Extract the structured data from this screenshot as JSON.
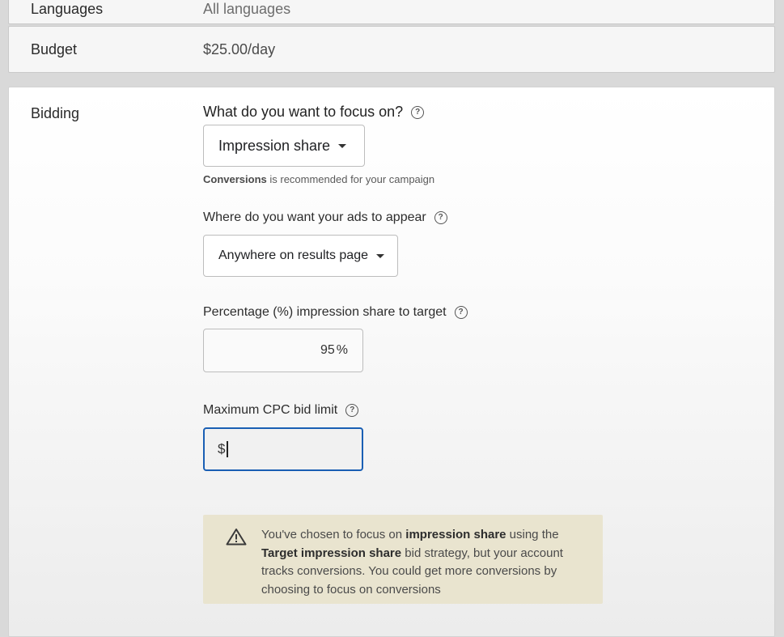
{
  "languages": {
    "label": "Languages",
    "value": "All languages"
  },
  "budget": {
    "label": "Budget",
    "value": "$25.00/day"
  },
  "bidding": {
    "label": "Bidding",
    "focus": {
      "question": "What do you want to focus on?",
      "selected": "Impression share",
      "hint_bold": "Conversions",
      "hint_rest": " is recommended for your campaign"
    },
    "location": {
      "question": "Where do you want your ads to appear",
      "selected": "Anywhere on results page"
    },
    "percentage": {
      "question": "Percentage (%) impression share to target",
      "value": "95",
      "unit": "%"
    },
    "cpc": {
      "question": "Maximum CPC bid limit",
      "prefix": "$",
      "value": ""
    },
    "warning": {
      "part1": "You've chosen to focus on ",
      "bold1": "impression share",
      "part2": " using the ",
      "bold2": "Target impression share",
      "part3": " bid strategy, but your account tracks conversions. You could get more conversions by choosing to focus on conversions"
    }
  },
  "icons": {
    "help": "help-circle-icon",
    "dropdown": "caret-down-icon",
    "warning": "warning-triangle-icon"
  },
  "colors": {
    "focus_border": "#1a5fb4",
    "warning_bg": "#e9e4cf"
  }
}
